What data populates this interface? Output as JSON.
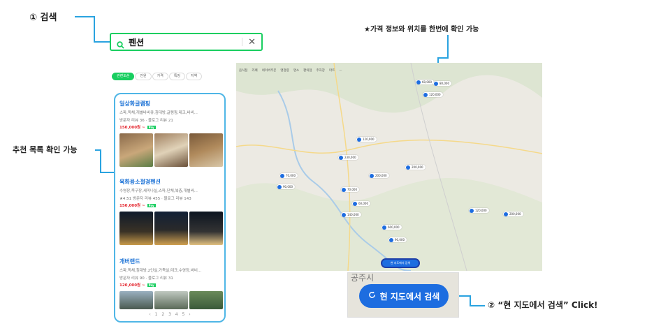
{
  "callouts": {
    "search": "① 검색",
    "recommend": "추천 목록 확인 가능",
    "price_map": "★가격 정보와 위치를 한번에 확인 가능",
    "click": "② “현 지도에서 검색” Click!"
  },
  "search": {
    "query": "펜션",
    "icon": "search-icon",
    "clear_icon": "close-icon"
  },
  "filters": [
    "관련도순",
    "전원",
    "가격",
    "특징",
    "지역"
  ],
  "listings": [
    {
      "name": "일상화글램핑",
      "desc": "스파,독채,개별바비큐,침대방,글램핑,테크,바비...",
      "meta": "방문자 리뷰 36 · 블로그 리뷰 21",
      "price": "150,000원 ~"
    },
    {
      "name": "육화용소절경펜션",
      "desc": "수영장,족구장,세미나실,스파,단체,복층,개별바...",
      "meta": "★4.51 방문자 리뷰 455 · 블로그 리뷰 143",
      "price": "150,000원 ~"
    },
    {
      "name": "개버랜드",
      "desc": "스파,독채,침대방,2인실,가족실,테크,수영장,바비...",
      "meta": "방문자 리뷰 90 · 블로그 리뷰 31",
      "price": "120,000원 ~"
    }
  ],
  "pager": "‹ 1 2 3 4 5 ›",
  "map": {
    "toolbar": [
      "음식점",
      "카페",
      "네이버주문",
      "명정량",
      "명소",
      "편의점",
      "주차장",
      "마트",
      "···"
    ],
    "pins": [
      "60,000",
      "80,000",
      "120,000",
      "120,000",
      "230,000",
      "200,000",
      "200,000",
      "70,000",
      "90,000",
      "70,000",
      "60,000",
      "140,000",
      "600,000",
      "90,000",
      "120,000",
      "200,000"
    ],
    "button": "현 지도에서 검색"
  },
  "zoomed_button": {
    "label": "현 지도에서 검색",
    "icon": "refresh-icon",
    "ghost": "공주시"
  },
  "colors": {
    "accent_green": "#19ce60",
    "accent_blue": "#1d6de0",
    "callout_line": "#2aa3e0",
    "price_red": "#e3262e"
  }
}
